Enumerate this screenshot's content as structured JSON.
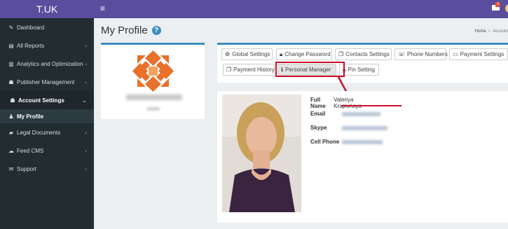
{
  "app": {
    "logo": "T.UK"
  },
  "sidebar": {
    "items": [
      {
        "label": "Dashboard",
        "icon": "dashboard-icon",
        "chevron": false
      },
      {
        "label": "All Reports",
        "icon": "list-icon",
        "chevron": true
      },
      {
        "label": "Analytics and Optimization",
        "icon": "chart-icon",
        "chevron": true
      },
      {
        "label": "Publisher Management",
        "icon": "users-icon",
        "chevron": true
      },
      {
        "label": "Account Settings",
        "icon": "group-icon",
        "chevron": true
      },
      {
        "label": "My Profile",
        "icon": "user-icon",
        "chevron": false
      },
      {
        "label": "Legal Documents",
        "icon": "book-icon",
        "chevron": true
      },
      {
        "label": "Feed CMS",
        "icon": "cloud-icon",
        "chevron": true
      },
      {
        "label": "Support",
        "icon": "envelope-icon",
        "chevron": true
      }
    ]
  },
  "topbar": {
    "menu_icon": "hamburger-icon",
    "mail_badge": "3",
    "mail_icon": "envelope-icon"
  },
  "page": {
    "title": "My Profile",
    "help_icon": "question-circle-icon"
  },
  "breadcrumb": {
    "home": "Home",
    "current": "Account"
  },
  "tabs": [
    {
      "label": "Global Settings",
      "icon": "cogs-icon"
    },
    {
      "label": "Change Password",
      "icon": "lock-icon"
    },
    {
      "label": "Contacts Settings",
      "icon": "copy-icon"
    },
    {
      "label": "Phone Numbers",
      "icon": "phone-icon"
    },
    {
      "label": "Payment Settings",
      "icon": "card-icon"
    },
    {
      "label": "Payment History",
      "icon": "copy-icon"
    },
    {
      "label": "Personal Manager",
      "icon": "info-icon"
    },
    {
      "label": "Pin Setting",
      "icon": "lock-icon"
    }
  ],
  "manager": {
    "full_name_label": "Full Name",
    "full_name": "Valeriya Krapivnaya",
    "email_label": "Email",
    "skype_label": "Skype",
    "cell_label": "Cell Phone"
  },
  "colors": {
    "brand": "#5b4d9e",
    "sidebar": "#222d32",
    "accent": "#3c8dbc",
    "highlight": "#c8102e"
  }
}
